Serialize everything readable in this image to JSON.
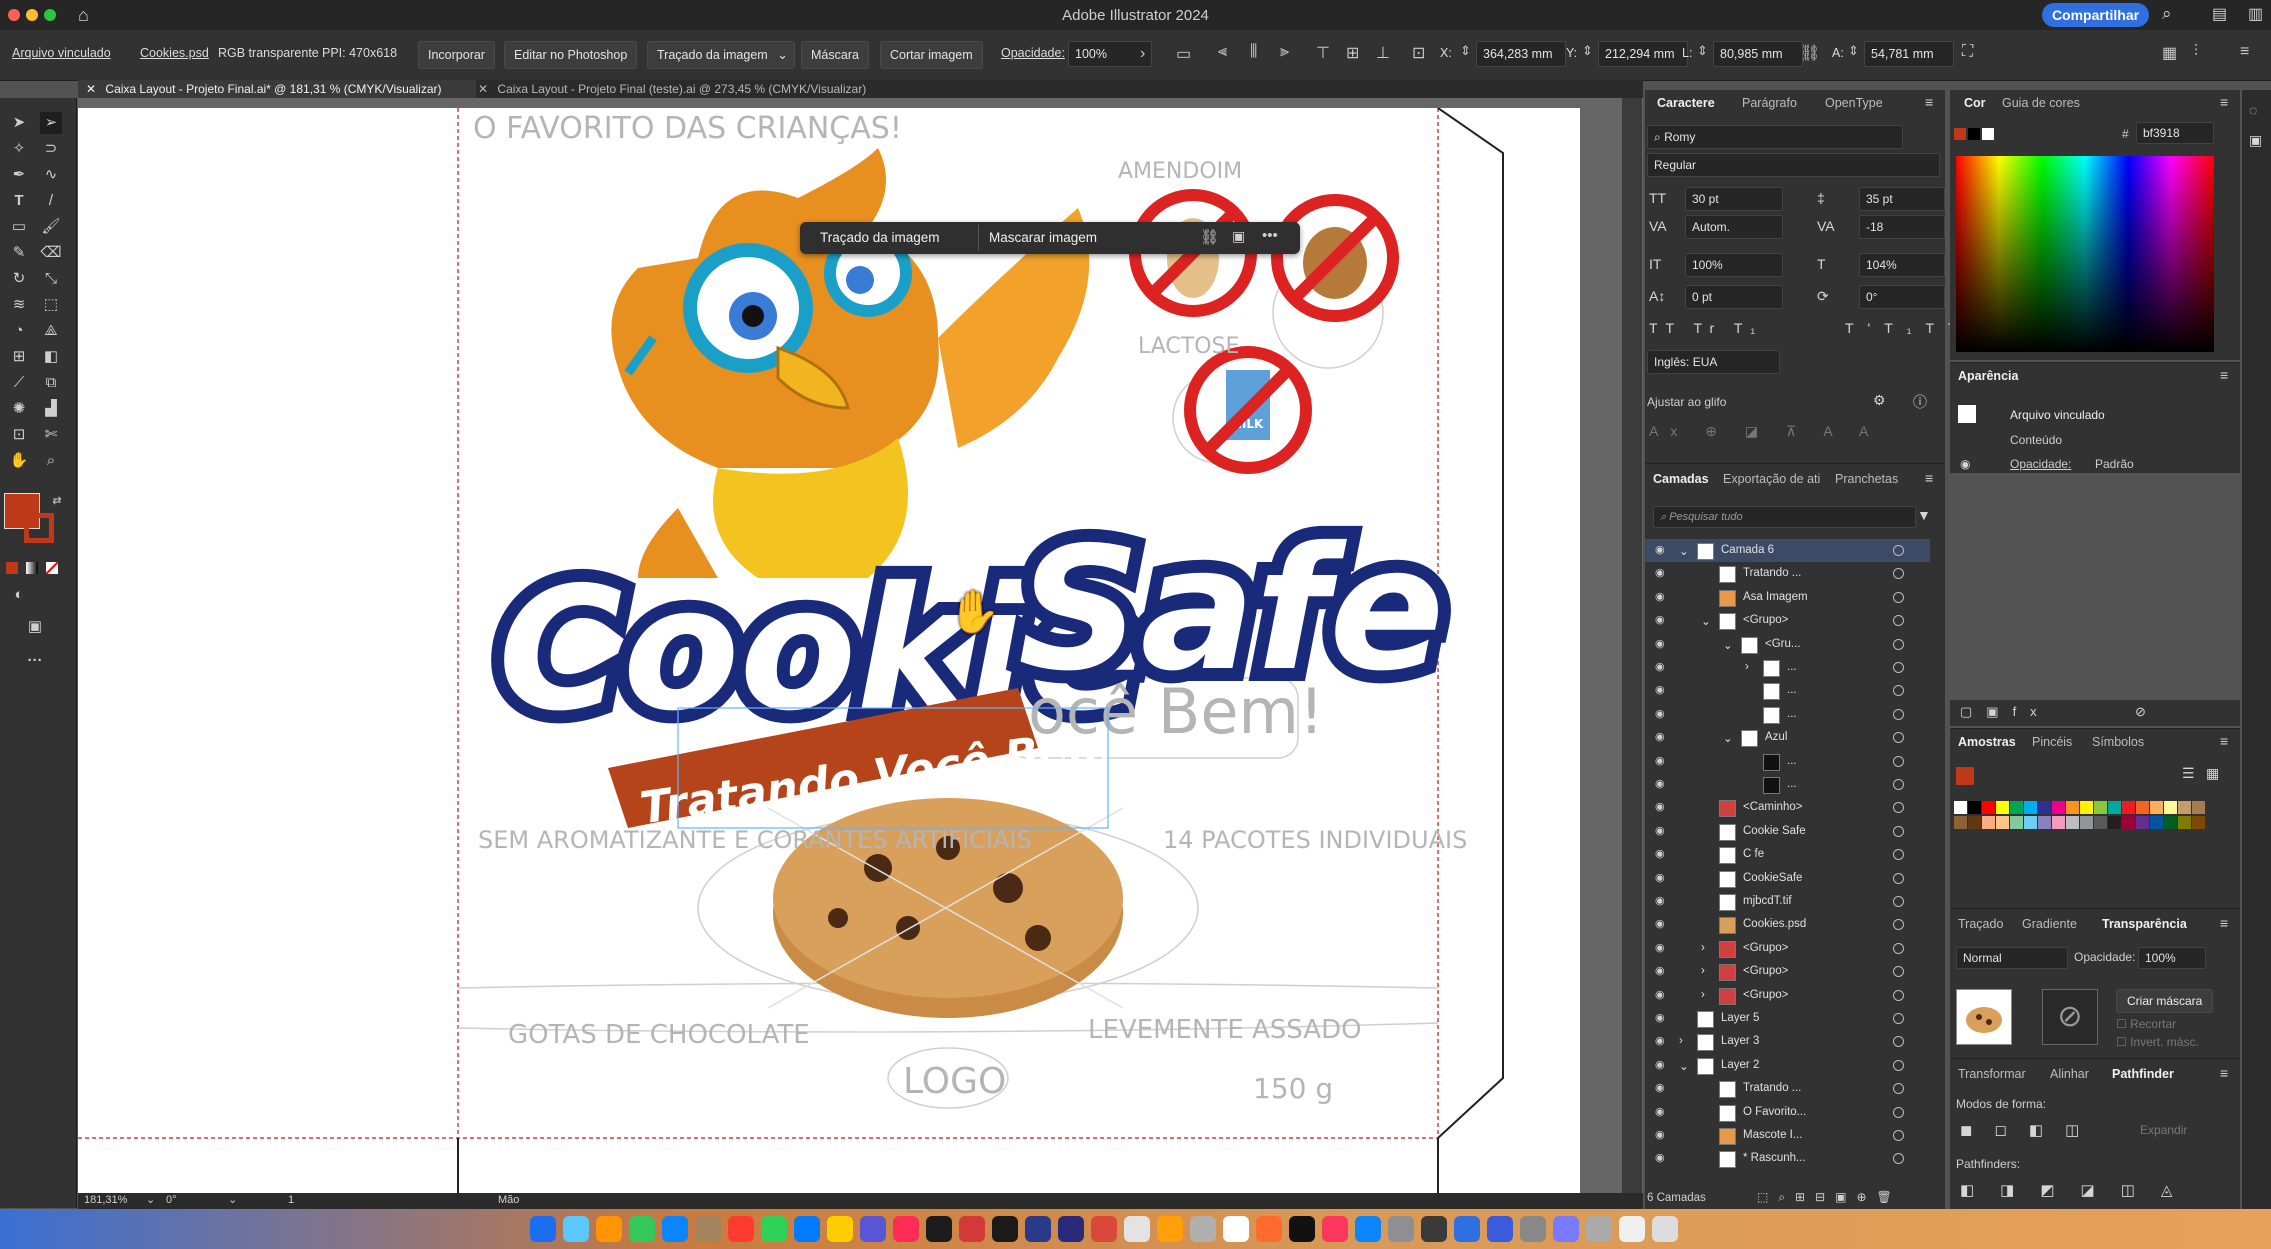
{
  "app": {
    "title": "Adobe Illustrator 2024",
    "share_label": "Compartilhar"
  },
  "controlbar": {
    "linked_file_label": "Arquivo vinculado",
    "file_name": "Cookies.psd",
    "file_info": "RGB transparente",
    "ppi": "PPI: 470x618",
    "embed_button": "Incorporar",
    "edit_photoshop_button": "Editar no Photoshop",
    "image_trace_button": "Traçado da imagem",
    "mask_button": "Máscara",
    "crop_button": "Cortar imagem",
    "opacity_label": "Opacidade:",
    "opacity_value": "100%",
    "x_label": "X:",
    "x_value": "364,283 mm",
    "y_label": "Y:",
    "y_value": "212,294 mm",
    "w_label": "L:",
    "w_value": "80,985 mm",
    "h_label": "A:",
    "h_value": "54,781 mm"
  },
  "tabs": [
    {
      "label": "Caixa Layout - Projeto Final.ai* @ 181,31 % (CMYK/Visualizar)",
      "active": true
    },
    {
      "label": "Caixa Layout - Projeto Final (teste).ai @ 273,45 % (CMYK/Visualizar)",
      "active": false
    }
  ],
  "context_bar": {
    "trace_button": "Traçado da imagem",
    "mask_button": "Mascarar imagem"
  },
  "artwork": {
    "logo_word_1": "Cookie",
    "logo_word_2": "Safe",
    "ribbon_text": "Tratando Você Bem!",
    "sketch_top_left": "O FAVORITO DAS CRIANÇAS!",
    "sketch_amendoim": "AMENDOIM",
    "sketch_lactose": "LACTOSE",
    "sketch_ribbon_ghost": "ocê Bem!",
    "sketch_left": "SEM AROMATIZANTE E CORANTES ARTIFICIAIS",
    "sketch_right": "14 PACOTES INDIVIDUAIS",
    "sketch_bottom_left": "GOTAS DE CHOCOLATE",
    "sketch_bottom_right": "LEVEMENTE ASSADO",
    "sketch_logo": "LOGO",
    "sketch_weight": "150 g",
    "milk_label": "MILK"
  },
  "statusbar": {
    "zoom": "181,31%",
    "rotation": "0°",
    "artboard": "1",
    "tool": "Mão"
  },
  "character_panel": {
    "tabs": [
      "Caractere",
      "Parágrafo",
      "OpenType"
    ],
    "font_family": "Romy",
    "font_style": "Regular",
    "font_size": "30 pt",
    "leading": "35 pt",
    "kerning": "Autom.",
    "tracking": "-18",
    "v_scale": "100%",
    "h_scale": "104%",
    "baseline": "0 pt",
    "rotation": "0°",
    "language": "Inglês: EUA",
    "snap_glyph": "Ajustar ao glifo"
  },
  "color_panel": {
    "tabs": [
      "Cor",
      "Guia de cores"
    ],
    "hex_label": "#",
    "hex": "bf3918"
  },
  "appearance_panel": {
    "title": "Aparência",
    "item": "Arquivo vinculado",
    "content": "Conteúdo",
    "opacity_label": "Opacidade:",
    "opacity_value": "Padrão"
  },
  "layers_panel": {
    "tabs": [
      "Camadas",
      "Exportação de ati",
      "Pranchetas"
    ],
    "search_placeholder": "Pesquisar tudo",
    "footer": "6 Camadas",
    "rows": [
      {
        "label": "Camada 6",
        "indent": 0,
        "twisty": "v"
      },
      {
        "label": "Tratando ...",
        "indent": 1,
        "twisty": ""
      },
      {
        "label": "Asa Imagem",
        "indent": 1,
        "twisty": ""
      },
      {
        "label": "<Grupo>",
        "indent": 1,
        "twisty": "v"
      },
      {
        "label": "<Gru...",
        "indent": 2,
        "twisty": "v"
      },
      {
        "label": "...",
        "indent": 3,
        "twisty": ">"
      },
      {
        "label": "...",
        "indent": 3,
        "twisty": ""
      },
      {
        "label": "...",
        "indent": 3,
        "twisty": ""
      },
      {
        "label": "Azul",
        "indent": 2,
        "twisty": "v"
      },
      {
        "label": "...",
        "indent": 3,
        "twisty": ""
      },
      {
        "label": "...",
        "indent": 3,
        "twisty": ""
      },
      {
        "label": "<Caminho>",
        "indent": 1,
        "twisty": ""
      },
      {
        "label": "Cookie Safe",
        "indent": 1,
        "twisty": ""
      },
      {
        "label": "C fe",
        "indent": 1,
        "twisty": ""
      },
      {
        "label": "CookieSafe",
        "indent": 1,
        "twisty": ""
      },
      {
        "label": "mjbcdT.tif",
        "indent": 1,
        "twisty": ""
      },
      {
        "label": "Cookies.psd",
        "indent": 1,
        "twisty": ""
      },
      {
        "label": "<Grupo>",
        "indent": 1,
        "twisty": ">"
      },
      {
        "label": "<Grupo>",
        "indent": 1,
        "twisty": ">"
      },
      {
        "label": "<Grupo>",
        "indent": 1,
        "twisty": ">"
      },
      {
        "label": "Layer 5",
        "indent": 0,
        "twisty": ""
      },
      {
        "label": "Layer 3",
        "indent": 0,
        "twisty": ">"
      },
      {
        "label": "Layer 2",
        "indent": 0,
        "twisty": "v"
      },
      {
        "label": "Tratando ...",
        "indent": 1,
        "twisty": ""
      },
      {
        "label": "O Favorito...",
        "indent": 1,
        "twisty": ""
      },
      {
        "label": "Mascote I...",
        "indent": 1,
        "twisty": ""
      },
      {
        "label": "* Rascunh...",
        "indent": 1,
        "twisty": ""
      }
    ]
  },
  "swatches_panel": {
    "tabs": [
      "Amostras",
      "Pincéis",
      "Símbolos"
    ]
  },
  "transparency_panel": {
    "tabs": [
      "Traçado",
      "Gradiente",
      "Transparência"
    ],
    "blend_mode": "Normal",
    "opacity_label": "Opacidade:",
    "opacity_value": "100%",
    "make_mask_button": "Criar máscara",
    "clip_label": "Recortar",
    "invert_label": "Invert. másc."
  },
  "pathfinder_panel": {
    "tabs": [
      "Transformar",
      "Alinhar",
      "Pathfinder"
    ],
    "shape_modes_label": "Modos de forma:",
    "expand_button": "Expandir",
    "pathfinders_label": "Pathfinders:"
  },
  "colors": {
    "accent": "#2f6fe0",
    "fill": "#bf3918",
    "brand_blue": "#1a2a7a",
    "ribbon": "#b5441a"
  }
}
